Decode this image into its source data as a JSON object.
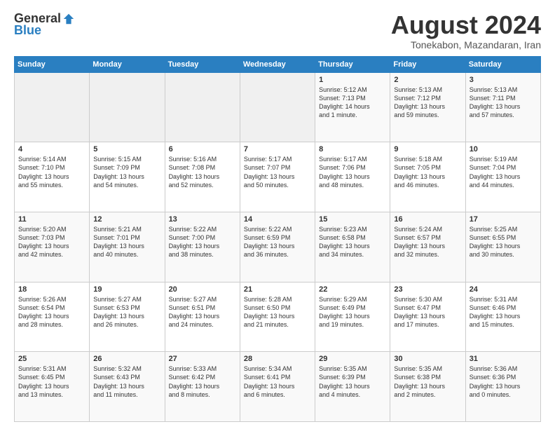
{
  "logo": {
    "general": "General",
    "blue": "Blue"
  },
  "header": {
    "month_year": "August 2024",
    "location": "Tonekabon, Mazandaran, Iran"
  },
  "days_of_week": [
    "Sunday",
    "Monday",
    "Tuesday",
    "Wednesday",
    "Thursday",
    "Friday",
    "Saturday"
  ],
  "weeks": [
    [
      {
        "num": "",
        "info": ""
      },
      {
        "num": "",
        "info": ""
      },
      {
        "num": "",
        "info": ""
      },
      {
        "num": "",
        "info": ""
      },
      {
        "num": "1",
        "info": "Sunrise: 5:12 AM\nSunset: 7:13 PM\nDaylight: 14 hours\nand 1 minute."
      },
      {
        "num": "2",
        "info": "Sunrise: 5:13 AM\nSunset: 7:12 PM\nDaylight: 13 hours\nand 59 minutes."
      },
      {
        "num": "3",
        "info": "Sunrise: 5:13 AM\nSunset: 7:11 PM\nDaylight: 13 hours\nand 57 minutes."
      }
    ],
    [
      {
        "num": "4",
        "info": "Sunrise: 5:14 AM\nSunset: 7:10 PM\nDaylight: 13 hours\nand 55 minutes."
      },
      {
        "num": "5",
        "info": "Sunrise: 5:15 AM\nSunset: 7:09 PM\nDaylight: 13 hours\nand 54 minutes."
      },
      {
        "num": "6",
        "info": "Sunrise: 5:16 AM\nSunset: 7:08 PM\nDaylight: 13 hours\nand 52 minutes."
      },
      {
        "num": "7",
        "info": "Sunrise: 5:17 AM\nSunset: 7:07 PM\nDaylight: 13 hours\nand 50 minutes."
      },
      {
        "num": "8",
        "info": "Sunrise: 5:17 AM\nSunset: 7:06 PM\nDaylight: 13 hours\nand 48 minutes."
      },
      {
        "num": "9",
        "info": "Sunrise: 5:18 AM\nSunset: 7:05 PM\nDaylight: 13 hours\nand 46 minutes."
      },
      {
        "num": "10",
        "info": "Sunrise: 5:19 AM\nSunset: 7:04 PM\nDaylight: 13 hours\nand 44 minutes."
      }
    ],
    [
      {
        "num": "11",
        "info": "Sunrise: 5:20 AM\nSunset: 7:03 PM\nDaylight: 13 hours\nand 42 minutes."
      },
      {
        "num": "12",
        "info": "Sunrise: 5:21 AM\nSunset: 7:01 PM\nDaylight: 13 hours\nand 40 minutes."
      },
      {
        "num": "13",
        "info": "Sunrise: 5:22 AM\nSunset: 7:00 PM\nDaylight: 13 hours\nand 38 minutes."
      },
      {
        "num": "14",
        "info": "Sunrise: 5:22 AM\nSunset: 6:59 PM\nDaylight: 13 hours\nand 36 minutes."
      },
      {
        "num": "15",
        "info": "Sunrise: 5:23 AM\nSunset: 6:58 PM\nDaylight: 13 hours\nand 34 minutes."
      },
      {
        "num": "16",
        "info": "Sunrise: 5:24 AM\nSunset: 6:57 PM\nDaylight: 13 hours\nand 32 minutes."
      },
      {
        "num": "17",
        "info": "Sunrise: 5:25 AM\nSunset: 6:55 PM\nDaylight: 13 hours\nand 30 minutes."
      }
    ],
    [
      {
        "num": "18",
        "info": "Sunrise: 5:26 AM\nSunset: 6:54 PM\nDaylight: 13 hours\nand 28 minutes."
      },
      {
        "num": "19",
        "info": "Sunrise: 5:27 AM\nSunset: 6:53 PM\nDaylight: 13 hours\nand 26 minutes."
      },
      {
        "num": "20",
        "info": "Sunrise: 5:27 AM\nSunset: 6:51 PM\nDaylight: 13 hours\nand 24 minutes."
      },
      {
        "num": "21",
        "info": "Sunrise: 5:28 AM\nSunset: 6:50 PM\nDaylight: 13 hours\nand 21 minutes."
      },
      {
        "num": "22",
        "info": "Sunrise: 5:29 AM\nSunset: 6:49 PM\nDaylight: 13 hours\nand 19 minutes."
      },
      {
        "num": "23",
        "info": "Sunrise: 5:30 AM\nSunset: 6:47 PM\nDaylight: 13 hours\nand 17 minutes."
      },
      {
        "num": "24",
        "info": "Sunrise: 5:31 AM\nSunset: 6:46 PM\nDaylight: 13 hours\nand 15 minutes."
      }
    ],
    [
      {
        "num": "25",
        "info": "Sunrise: 5:31 AM\nSunset: 6:45 PM\nDaylight: 13 hours\nand 13 minutes."
      },
      {
        "num": "26",
        "info": "Sunrise: 5:32 AM\nSunset: 6:43 PM\nDaylight: 13 hours\nand 11 minutes."
      },
      {
        "num": "27",
        "info": "Sunrise: 5:33 AM\nSunset: 6:42 PM\nDaylight: 13 hours\nand 8 minutes."
      },
      {
        "num": "28",
        "info": "Sunrise: 5:34 AM\nSunset: 6:41 PM\nDaylight: 13 hours\nand 6 minutes."
      },
      {
        "num": "29",
        "info": "Sunrise: 5:35 AM\nSunset: 6:39 PM\nDaylight: 13 hours\nand 4 minutes."
      },
      {
        "num": "30",
        "info": "Sunrise: 5:35 AM\nSunset: 6:38 PM\nDaylight: 13 hours\nand 2 minutes."
      },
      {
        "num": "31",
        "info": "Sunrise: 5:36 AM\nSunset: 6:36 PM\nDaylight: 13 hours\nand 0 minutes."
      }
    ]
  ]
}
